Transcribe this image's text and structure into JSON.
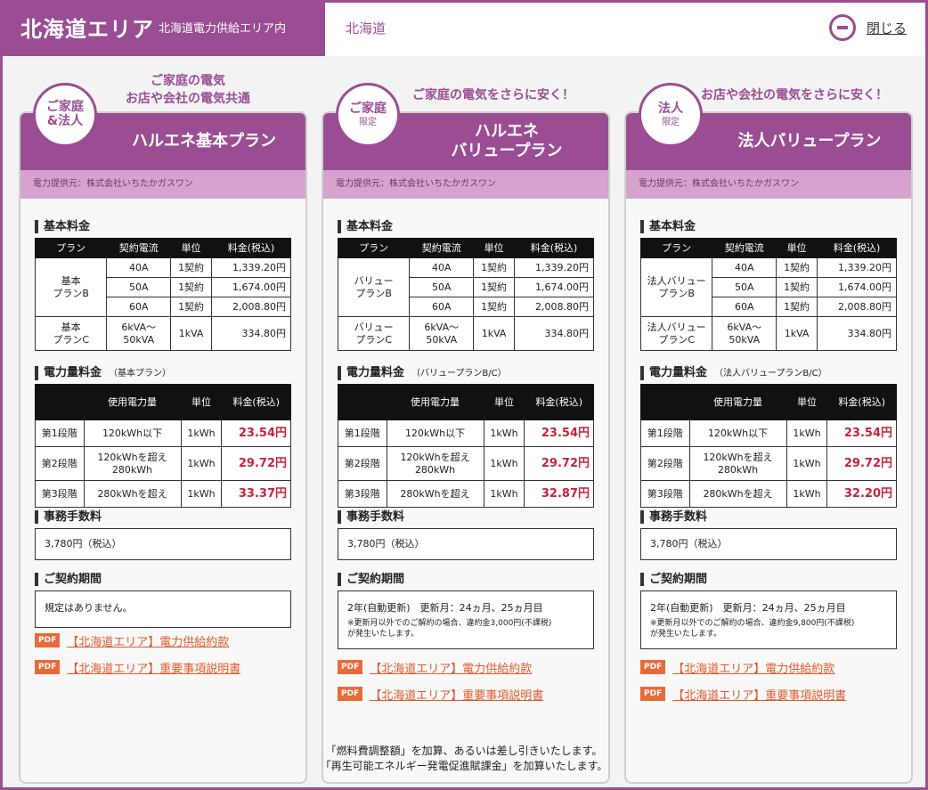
{
  "header": {
    "area_title": "北海道エリア",
    "area_sub": "北海道電力供給エリア内",
    "region": "北海道",
    "close_label": "閉じる",
    "close_icon": "minus-circle-icon"
  },
  "colors": {
    "brand": "#9b4d94",
    "brand_light": "#d5a3cd",
    "price_red": "#c8233a",
    "pdf_orange": "#e86a3a"
  },
  "cards": [
    {
      "tagline": "ご家庭の電気\nお店や会社の電気共通",
      "badge_main": "ご家庭\n&法人",
      "badge_sub": "",
      "title": "ハルエネ基本プラン",
      "provider": "電力提供元：株式会社いちたかガスワン",
      "basic_heading": "基本料金",
      "basic_headers": [
        "プラン",
        "契約電流",
        "単位",
        "料金(税込)"
      ],
      "plan_b_name": "基本\nプランB",
      "amp_rows": [
        {
          "amp": "40A",
          "unit": "1契約",
          "price": "1,339.20円"
        },
        {
          "amp": "50A",
          "unit": "1契約",
          "price": "1,674.00円"
        },
        {
          "amp": "60A",
          "unit": "1契約",
          "price": "2,008.80円"
        }
      ],
      "plan_c": {
        "name": "基本\nプランC",
        "amp": "6kVA～\n50kVA",
        "unit": "1kVA",
        "price": "334.80円"
      },
      "usage_heading": "電力量料金",
      "usage_note": "（基本プラン）",
      "usage_headers": [
        "",
        "使用電力量",
        "単位",
        "料金(税込)"
      ],
      "usage_rows": [
        {
          "tier": "第1段階",
          "range": "120kWh以下",
          "unit": "1kWh",
          "price": "23.54円"
        },
        {
          "tier": "第2段階",
          "range": "120kWhを超え\n280kWh",
          "unit": "1kWh",
          "price": "29.72円"
        },
        {
          "tier": "第3段階",
          "range": "280kWhを超え",
          "unit": "1kWh",
          "price": "33.37円"
        }
      ],
      "fee_heading": "事務手数料",
      "fee": "3,780円（税込）",
      "contract_heading": "ご契約期間",
      "contract_text": "規定はありません。",
      "contract_note": "",
      "pdf_icon": "PDF",
      "pdf_links": [
        "【北海道エリア】電力供給約款",
        "【北海道エリア】重要事項説明書"
      ]
    },
    {
      "tagline": "ご家庭の電気をさらに安く！",
      "badge_main": "ご家庭",
      "badge_sub": "限定",
      "title": "ハルエネ\nバリュープラン",
      "provider": "電力提供元：株式会社いちたかガスワン",
      "basic_heading": "基本料金",
      "basic_headers": [
        "プラン",
        "契約電流",
        "単位",
        "料金(税込)"
      ],
      "plan_b_name": "バリュー\nプランB",
      "amp_rows": [
        {
          "amp": "40A",
          "unit": "1契約",
          "price": "1,339.20円"
        },
        {
          "amp": "50A",
          "unit": "1契約",
          "price": "1,674.00円"
        },
        {
          "amp": "60A",
          "unit": "1契約",
          "price": "2,008.80円"
        }
      ],
      "plan_c": {
        "name": "バリュー\nプランC",
        "amp": "6kVA～\n50kVA",
        "unit": "1kVA",
        "price": "334.80円"
      },
      "usage_heading": "電力量料金",
      "usage_note": "（バリュープランB/C）",
      "usage_headers": [
        "",
        "使用電力量",
        "単位",
        "料金(税込)"
      ],
      "usage_rows": [
        {
          "tier": "第1段階",
          "range": "120kWh以下",
          "unit": "1kWh",
          "price": "23.54円"
        },
        {
          "tier": "第2段階",
          "range": "120kWhを超え\n280kWh",
          "unit": "1kWh",
          "price": "29.72円"
        },
        {
          "tier": "第3段階",
          "range": "280kWhを超え",
          "unit": "1kWh",
          "price": "32.87円"
        }
      ],
      "fee_heading": "事務手数料",
      "fee": "3,780円（税込）",
      "contract_heading": "ご契約期間",
      "contract_text": "2年(自動更新)　更新月：24ヵ月、25ヵ月目",
      "contract_note": "※更新月以外でのご解約の場合、違約金3,000円(不課税)\nが発生いたします。",
      "pdf_icon": "PDF",
      "pdf_links": [
        "【北海道エリア】電力供給約款",
        "【北海道エリア】重要事項説明書"
      ]
    },
    {
      "tagline": "お店や会社の電気をさらに安く！",
      "badge_main": "法人",
      "badge_sub": "限定",
      "title": "法人バリュープラン",
      "provider": "電力提供元：株式会社いちたかガスワン",
      "basic_heading": "基本料金",
      "basic_headers": [
        "プラン",
        "契約電流",
        "単位",
        "料金(税込)"
      ],
      "plan_b_name": "法人バリュー\nプランB",
      "amp_rows": [
        {
          "amp": "40A",
          "unit": "1契約",
          "price": "1,339.20円"
        },
        {
          "amp": "50A",
          "unit": "1契約",
          "price": "1,674.00円"
        },
        {
          "amp": "60A",
          "unit": "1契約",
          "price": "2,008.80円"
        }
      ],
      "plan_c": {
        "name": "法人バリュー\nプランC",
        "amp": "6kVA～\n50kVA",
        "unit": "1kVA",
        "price": "334.80円"
      },
      "usage_heading": "電力量料金",
      "usage_note": "（法人バリュープランB/C）",
      "usage_headers": [
        "",
        "使用電力量",
        "単位",
        "料金(税込)"
      ],
      "usage_rows": [
        {
          "tier": "第1段階",
          "range": "120kWh以下",
          "unit": "1kWh",
          "price": "23.54円"
        },
        {
          "tier": "第2段階",
          "range": "120kWhを超え\n280kWh",
          "unit": "1kWh",
          "price": "29.72円"
        },
        {
          "tier": "第3段階",
          "range": "280kWhを超え",
          "unit": "1kWh",
          "price": "32.20円"
        }
      ],
      "fee_heading": "事務手数料",
      "fee": "3,780円（税込）",
      "contract_heading": "ご契約期間",
      "contract_text": "2年(自動更新)　更新月：24ヵ月、25ヵ月目",
      "contract_note": "※更新月以外でのご解約の場合、違約金9,800円(不課税)\nが発生いたします。",
      "pdf_icon": "PDF",
      "pdf_links": [
        "【北海道エリア】電力供給約款",
        "【北海道エリア】重要事項説明書"
      ]
    }
  ],
  "footer": [
    "「燃料費調整額」を加算、あるいは差し引きいたします。",
    "「再生可能エネルギー発電促進賦課金」を加算いたします。"
  ]
}
